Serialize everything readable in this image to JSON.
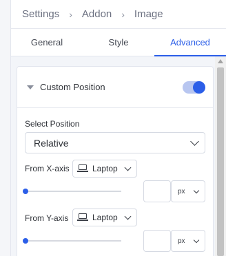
{
  "breadcrumb": {
    "items": [
      "Settings",
      "Addon",
      "Image"
    ],
    "separator": "›"
  },
  "tabs": [
    {
      "label": "General",
      "active": false
    },
    {
      "label": "Style",
      "active": false
    },
    {
      "label": "Advanced",
      "active": true
    }
  ],
  "section": {
    "title": "Custom Position",
    "enabled": true
  },
  "position": {
    "label": "Select Position",
    "value": "Relative"
  },
  "x_axis": {
    "label": "From X-axis",
    "device": "Laptop",
    "slider_value": 0,
    "input_value": "",
    "unit": "px"
  },
  "y_axis": {
    "label": "From Y-axis",
    "device": "Laptop",
    "slider_value": 0,
    "input_value": "",
    "unit": "px"
  },
  "colors": {
    "accent": "#2b5ee8",
    "toggle_track": "#b8c6f0",
    "background": "#f3f5f9"
  }
}
